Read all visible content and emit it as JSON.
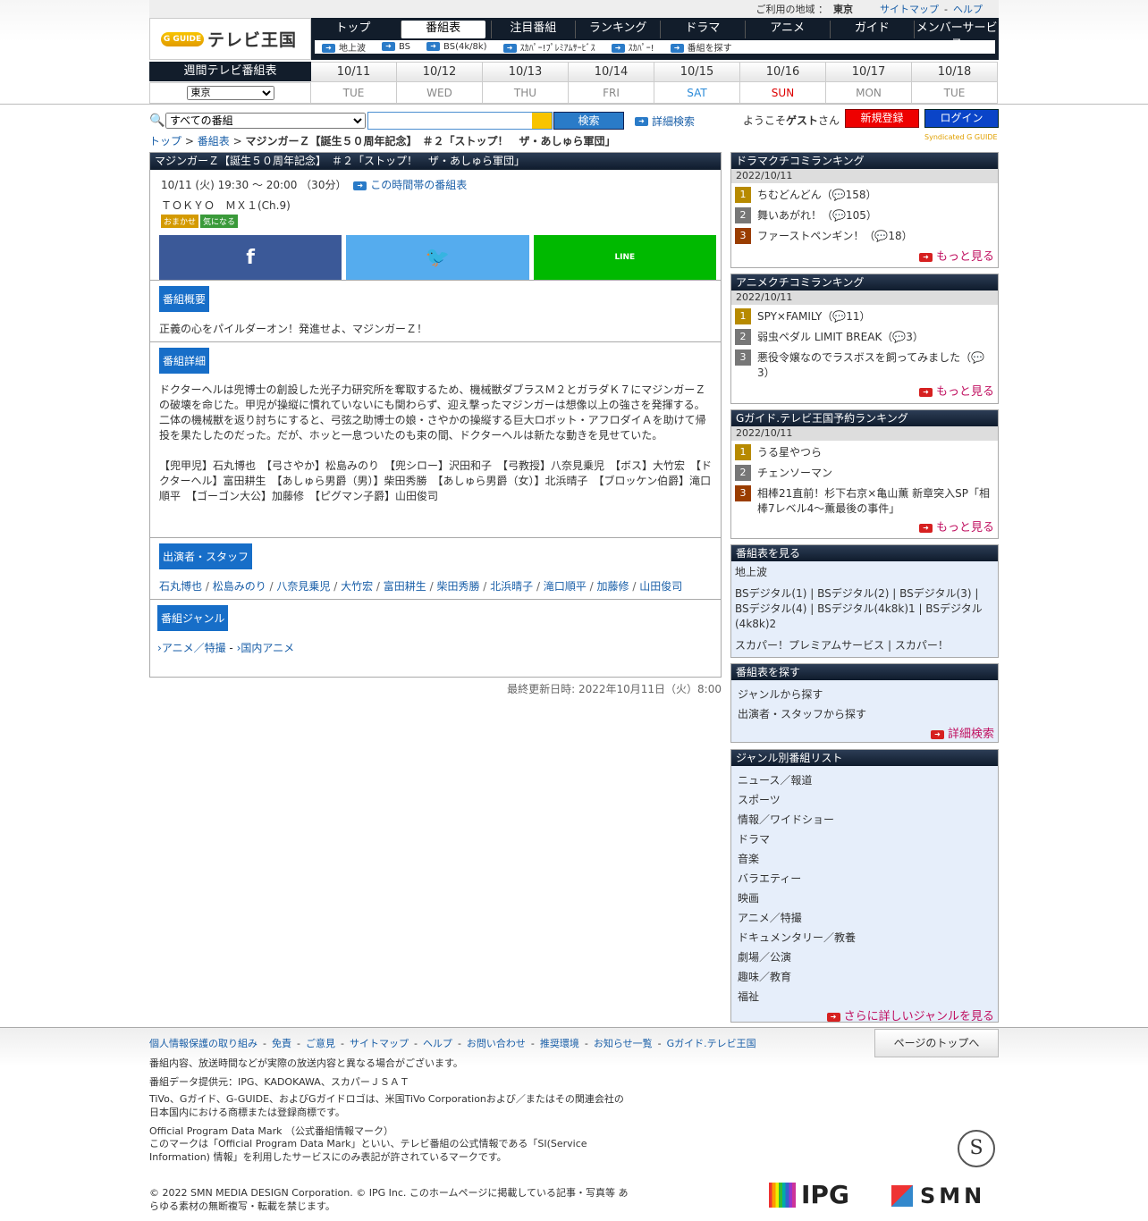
{
  "topbar": {
    "region_label": "ご利用の地域 ：",
    "region": "東京",
    "sitemap": "サイトマップ",
    "sep": "-",
    "help": "ヘルプ"
  },
  "logo": {
    "mark": "G GUIDE",
    "text": "テレビ王国"
  },
  "nav": {
    "tabs": [
      "トップ",
      "番組表",
      "注目番組",
      "ランキング",
      "ドラマ",
      "アニメ",
      "ガイド",
      "メンバーサービス"
    ],
    "sub": [
      "地上波",
      "BS",
      "BS(4k/8k)",
      "ｽｶﾊﾟｰ!ﾌﾟﾚﾐｱﾑｻｰﾋﾞｽ",
      "ｽｶﾊﾟｰ!",
      "番組を探す"
    ]
  },
  "week": {
    "label": "週間テレビ番組表",
    "select": "東京",
    "days": [
      {
        "date": "10/11",
        "wd": "TUE"
      },
      {
        "date": "10/12",
        "wd": "WED"
      },
      {
        "date": "10/13",
        "wd": "THU"
      },
      {
        "date": "10/14",
        "wd": "FRI"
      },
      {
        "date": "10/15",
        "wd": "SAT"
      },
      {
        "date": "10/16",
        "wd": "SUN"
      },
      {
        "date": "10/17",
        "wd": "MON"
      },
      {
        "date": "10/18",
        "wd": "TUE"
      }
    ]
  },
  "search": {
    "select": "すべての番組",
    "button": "検索",
    "advanced": "詳細検索"
  },
  "user": {
    "welcome_pre": "ようこそ",
    "guest": "ゲスト",
    "welcome_post": "さん",
    "register": "新規登録",
    "login": "ログイン"
  },
  "crumb": {
    "top": "トップ",
    "sep": ">",
    "grid": "番組表",
    "current": "マジンガーＺ【誕生５０周年記念】　＃２「ストップ！　ザ・あしゅら軍団」"
  },
  "synd": "Syndicated G GUIDE",
  "program": {
    "title": "マジンガーＺ【誕生５０周年記念】　＃２「ストップ！　ザ・あしゅら軍団」",
    "time": "10/11 (火) 19:30 ～ 20:00 （30分）",
    "timelink": "この時間帯の番組表",
    "channel": "ＴＯＫＹＯ　ＭＸ１(Ch.9)",
    "badges": [
      "おまかせ",
      "気になる"
    ],
    "sns": [
      "f",
      "t",
      "LINE"
    ],
    "summary_head": "番組概要",
    "summary": "正義の心をパイルダーオン！発進せよ、マジンガーＺ！",
    "detail_head": "番組詳細",
    "detail": "ドクターヘルは兜博士の創設した光子力研究所を奪取するため、機械獣ダブラスＭ２とガラダＫ７にマジンガーＺの破壊を命じた。甲児が操縦に慣れていないにも関わらず、迎え撃ったマジンガーは想像以上の強さを発揮する。二体の機械獣を返り討ちにすると、弓弦之助博士の娘・さやかの操縦する巨大ロボット・アフロダイＡを助けて帰投を果たしたのだった。だが、ホッと一息ついたのも束の間、ドクターヘルは新たな動きを見せていた。",
    "cast": "【兜甲児】石丸博也　【弓さやか】松島みのり　【兜シロー】沢田和子　【弓教授】八奈見乗児　【ボス】大竹宏　【ドクターヘル】富田耕生　【あしゅら男爵（男）】柴田秀勝　【あしゅら男爵（女）】北浜晴子　【ブロッケン伯爵】滝口順平　【ゴーゴン大公】加藤修　【ピグマン子爵】山田俊司",
    "staff_head": "出演者・スタッフ",
    "staff": [
      "石丸博也",
      "松島みのり",
      "八奈見乗児",
      "大竹宏",
      "富田耕生",
      "柴田秀勝",
      "北浜晴子",
      "滝口順平",
      "加藤修",
      "山田俊司"
    ],
    "genre_head": "番組ジャンル",
    "genre1": "アニメ／特撮",
    "genre_sep": "-",
    "genre2": "国内アニメ",
    "updated": "最終更新日時: 2022年10月11日（火）8:00"
  },
  "side": {
    "drama": {
      "title": "ドラマクチコミランキング",
      "date": "2022/10/11",
      "items": [
        {
          "name": "ちむどんどん（",
          "count": "158）"
        },
        {
          "name": "舞いあがれ！（",
          "count": "105）"
        },
        {
          "name": "ファーストペンギン！（",
          "count": "18）"
        }
      ],
      "more": "もっと見る"
    },
    "anime": {
      "title": "アニメクチコミランキング",
      "date": "2022/10/11",
      "items": [
        {
          "name": "SPY×FAMILY（",
          "count": "11）"
        },
        {
          "name": "弱虫ペダル LIMIT BREAK（",
          "count": "3）"
        },
        {
          "name": "悪役令嬢なのでラスボスを飼ってみました（",
          "count": "3）"
        }
      ],
      "more": "もっと見る"
    },
    "reserve": {
      "title": "Gガイド.テレビ王国予約ランキング",
      "date": "2022/10/11",
      "items": [
        "うる星やつら",
        "チェンソーマン",
        "相棒21直前！杉下右京×亀山薫 新章突入SP「相棒7レベル4〜薫最後の事件」"
      ],
      "more": "もっと見る"
    },
    "view": {
      "title": "番組表を見る",
      "l1": "地上波",
      "l2": "BSデジタル(1) | BSデジタル(2) | BSデジタル(3) | BSデジタル(4) | BSデジタル(4k8k)1 | BSデジタル(4k8k)2",
      "l3": "スカパー！プレミアムサービス | スカパー！"
    },
    "find": {
      "title": "番組表を探す",
      "items": [
        "ジャンルから探す",
        "出演者・スタッフから探す"
      ],
      "more": "詳細検索"
    },
    "genres": {
      "title": "ジャンル別番組リスト",
      "items": [
        "ニュース／報道",
        "スポーツ",
        "情報／ワイドショー",
        "ドラマ",
        "音楽",
        "バラエティー",
        "映画",
        "アニメ／特撮",
        "ドキュメンタリー／教養",
        "劇場／公演",
        "趣味／教育",
        "福祉"
      ],
      "more": "さらに詳しいジャンルを見る"
    }
  },
  "footer": {
    "links": [
      "個人情報保護の取り組み",
      "免責",
      "ご意見",
      "サイトマップ",
      "ヘルプ",
      "お問い合わせ",
      "推奨環境",
      "お知らせ一覧",
      "Gガイド.テレビ王国"
    ],
    "sep": "-",
    "pagetop": "ページのトップへ",
    "note1": "番組内容、放送時間などが実際の放送内容と異なる場合がございます。",
    "note2": "番組データ提供元：IPG、KADOKAWA、スカパーＪＳＡＴ",
    "note3": "TiVo、Gガイド、G-GUIDE、およびGガイドロゴは、米国TiVo Corporationおよび／またはその関連会社の日本国内における商標または登録商標です。",
    "note4": "Official Program Data Mark （公式番組情報マーク）",
    "note5": "このマークは「Official Program Data Mark」といい、テレビ番組の公式情報である「SI(Service Information) 情報」を利用したサービスにのみ表記が許されているマークです。",
    "copyright": "© 2022 SMN MEDIA DESIGN Corporation. © IPG Inc. このホームページに掲載している記事・写真等 あらゆる素材の無断複写・転載を禁じます。",
    "mark": "S",
    "ipg": "IPG",
    "smn": "SMN"
  }
}
